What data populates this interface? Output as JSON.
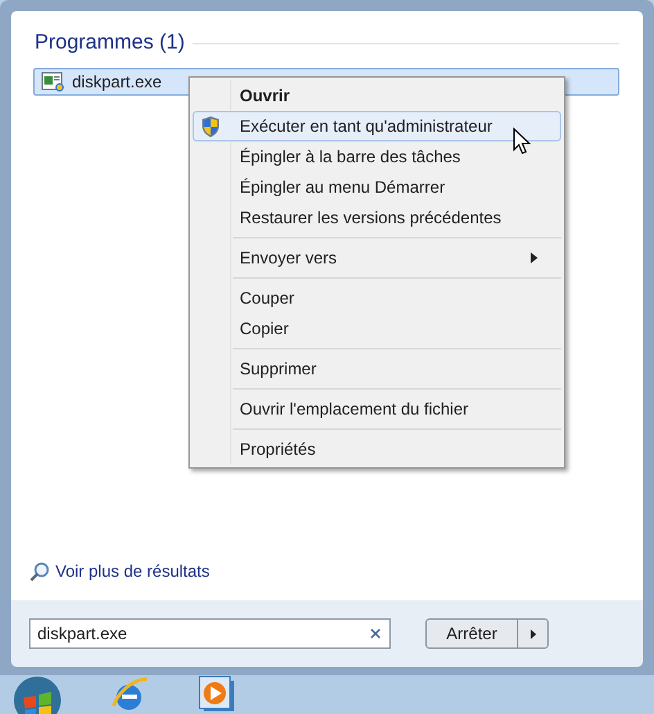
{
  "results": {
    "heading": "Programmes (1)",
    "items": [
      {
        "label": "diskpart.exe",
        "selected": true
      }
    ]
  },
  "context_menu": {
    "groups": [
      [
        {
          "kind": "plain",
          "label": "Ouvrir",
          "default": true,
          "selected": false
        },
        {
          "kind": "uac",
          "label": "Exécuter en tant qu'administrateur",
          "default": false,
          "selected": true
        },
        {
          "kind": "plain",
          "label": "Épingler à la barre des tâches",
          "default": false,
          "selected": false
        },
        {
          "kind": "plain",
          "label": "Épingler au menu Démarrer",
          "default": false,
          "selected": false
        },
        {
          "kind": "plain",
          "label": "Restaurer les versions précédentes",
          "default": false,
          "selected": false
        }
      ],
      [
        {
          "kind": "submenu",
          "label": "Envoyer vers",
          "default": false,
          "selected": false
        }
      ],
      [
        {
          "kind": "plain",
          "label": "Couper",
          "default": false,
          "selected": false
        },
        {
          "kind": "plain",
          "label": "Copier",
          "default": false,
          "selected": false
        }
      ],
      [
        {
          "kind": "plain",
          "label": "Supprimer",
          "default": false,
          "selected": false
        }
      ],
      [
        {
          "kind": "plain",
          "label": "Ouvrir l'emplacement du fichier",
          "default": false,
          "selected": false
        }
      ],
      [
        {
          "kind": "plain",
          "label": "Propriétés",
          "default": false,
          "selected": false
        }
      ]
    ]
  },
  "more_results": "Voir plus de résultats",
  "search": {
    "value": "diskpart.exe"
  },
  "power_button": {
    "label": "Arrêter"
  }
}
